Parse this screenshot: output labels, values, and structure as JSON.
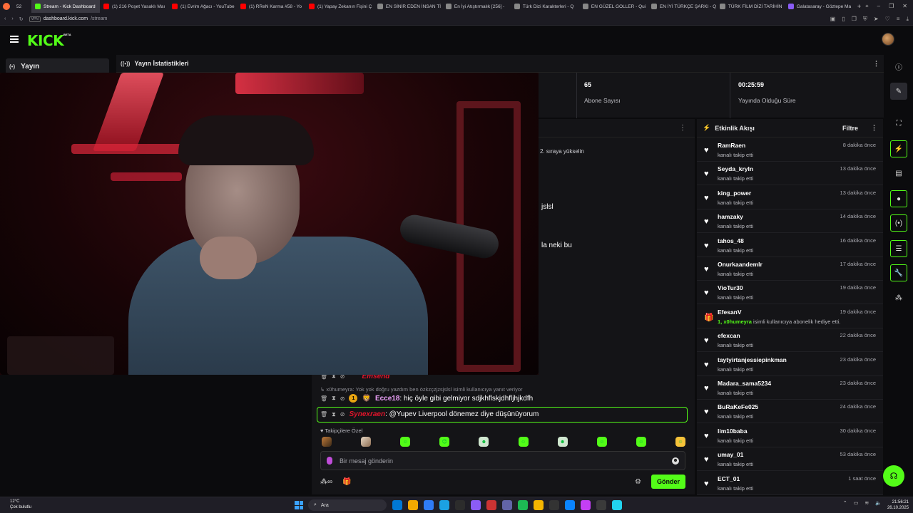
{
  "browser": {
    "tabs": [
      {
        "label": "52",
        "color": "#555"
      },
      {
        "label": "Stream - Kick Dashboard",
        "color": "#53fc18",
        "active": true
      },
      {
        "label": "(1) 216 Poşet Yasaklı Maı",
        "color": "#ff0000"
      },
      {
        "label": "(1) Evrim Ağacı - YouTube",
        "color": "#ff0000"
      },
      {
        "label": "(1) RReN Karma #58 - Yo",
        "color": "#ff0000"
      },
      {
        "label": "(1) Yapay Zekanın Fişini Ç",
        "color": "#ff0000"
      },
      {
        "label": "EN SİNİR EDEN İNSAN Tİ",
        "color": "#888"
      },
      {
        "label": "En İyi Atıştırmalık [256] -",
        "color": "#888"
      },
      {
        "label": "Türk Dizi Karakterleri - Q",
        "color": "#888"
      },
      {
        "label": "EN GÜZEL GOLLER - Qui",
        "color": "#888"
      },
      {
        "label": "EN İYİ TÜRKÇE ŞARKI - Q",
        "color": "#888"
      },
      {
        "label": "TÜRK FİLM DİZİ TARİHİN",
        "color": "#888"
      },
      {
        "label": "Galatasaray - Göztepe Ma",
        "color": "#8a5cf6"
      }
    ],
    "url_badge": "VPN",
    "url_host": "dashboard.kick.com",
    "url_path": "/stream"
  },
  "header": {
    "logo": "KICK",
    "beta": "BETA"
  },
  "left_panel": {
    "label": "Yayın"
  },
  "stats": {
    "title": "Yayın İstatistikleri",
    "subscribers_value": "65",
    "subscribers_label": "Abone Sayısı",
    "uptime_value": "00:25:59",
    "uptime_label": "Yayında Olduğu Süre"
  },
  "chat": {
    "fragment_1": "2. sıraya yükselin",
    "fragment_2": "jslsl",
    "fragment_3": "la neki bu",
    "partial_user": "Emsend",
    "reply_text": "x0humeyra: Yok yok doğru yazdım ben özkzçzjzsjslsl isimli kullanıcıya yanıt veriyor",
    "line1_badge": "1",
    "line1_user": "Ecce18",
    "line1_msg": "hiç öyle gibi gelmiyor sdjkhflskjdhfljhjkdfh",
    "line2_user": "Synexraen",
    "line2_msg": "@Yupev Liverpool dönemez diye düşünüyorum",
    "followers_only": "Takipçilere Özel",
    "input_placeholder": "Bir mesaj gönderin",
    "send_label": "Gönder",
    "infinity": "∞"
  },
  "activity": {
    "title": "Etkinlik Akışı",
    "filter_label": "Filtre",
    "items": [
      {
        "name": "RamRaen",
        "text": "kanalı takip etti",
        "time": "8 dakika önce"
      },
      {
        "name": "Seyda_kryln",
        "text": "kanalı takip etti",
        "time": "13 dakika önce"
      },
      {
        "name": "king_power",
        "text": "kanalı takip etti",
        "time": "13 dakika önce"
      },
      {
        "name": "hamzaky",
        "text": "kanalı takip etti",
        "time": "14 dakika önce"
      },
      {
        "name": "tahos_48",
        "text": "kanalı takip etti",
        "time": "16 dakika önce"
      },
      {
        "name": "Onurkaandemlr",
        "text": "kanalı takip etti",
        "time": "17 dakika önce"
      },
      {
        "name": "VioTur30",
        "text": "kanalı takip etti",
        "time": "19 dakika önce"
      },
      {
        "name": "EfesanV",
        "gift_highlight": "1, x0humeyra",
        "text": "isimli kullanıcıya abonelik hediye etti.",
        "time": "19 dakika önce",
        "gift": true
      },
      {
        "name": "efexcan",
        "text": "kanalı takip etti",
        "time": "22 dakika önce"
      },
      {
        "name": "taytyirtanjessiepinkman",
        "text": "kanalı takip etti",
        "time": "23 dakika önce"
      },
      {
        "name": "Madara_sama5234",
        "text": "kanalı takip etti",
        "time": "23 dakika önce"
      },
      {
        "name": "BuRaKeFe025",
        "text": "kanalı takip etti",
        "time": "24 dakika önce"
      },
      {
        "name": "lim10baba",
        "text": "kanalı takip etti",
        "time": "30 dakika önce"
      },
      {
        "name": "umay_01",
        "text": "kanalı takip etti",
        "time": "53 dakika önce"
      },
      {
        "name": "ECT_01",
        "text": "kanalı takip etti",
        "time": "1 saat önce"
      }
    ]
  },
  "taskbar": {
    "temp": "12°C",
    "weather": "Çok bulutlu",
    "search": "Ara",
    "time": "21:56:21",
    "date": "26.10.2025"
  },
  "colors": {
    "accent": "#53fc18",
    "panel": "#141417",
    "background": "#0b0b0d"
  }
}
